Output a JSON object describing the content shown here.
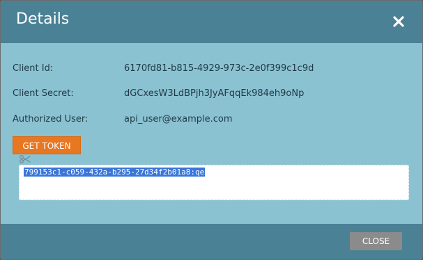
{
  "dialog": {
    "title": "Details",
    "close_icon": "close-icon"
  },
  "fields": [
    {
      "label": "Client Id:",
      "value": "6170fd81-b815-4929-973c-2e0f399c1c9d"
    },
    {
      "label": "Client Secret:",
      "value": "dGCxesW3LdBPjh3JyAFqqEk984eh9oNp"
    },
    {
      "label": "Authorized User:",
      "value": "api_user@example.com"
    }
  ],
  "token": {
    "button_label": "GET TOKEN",
    "copy_icon": "scissors-icon",
    "value": "799153c1-c059-432a-b295-27d34f2b01a8:qe"
  },
  "footer": {
    "close_label": "CLOSE"
  },
  "colors": {
    "header": "#4a8195",
    "body": "#8ac2d2",
    "accent": "#e87722",
    "close_button": "#8b8b8b",
    "selection": "#3a76d8"
  }
}
